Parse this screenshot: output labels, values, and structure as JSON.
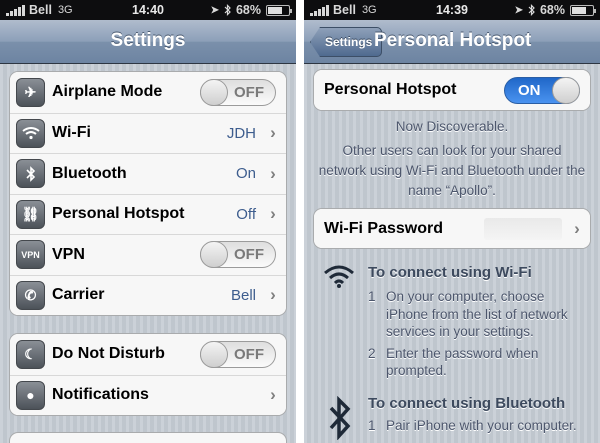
{
  "left": {
    "status": {
      "carrier": "Bell",
      "network": "3G",
      "time": "14:40",
      "battery": "68%"
    },
    "nav_title": "Settings",
    "group1": [
      {
        "label": "Airplane Mode",
        "control": "toggle",
        "toggle_label": "OFF",
        "icon": "airplane-icon",
        "glyph": "✈"
      },
      {
        "label": "Wi-Fi",
        "value": "JDH",
        "icon": "wifi-icon",
        "glyph": ""
      },
      {
        "label": "Bluetooth",
        "value": "On",
        "icon": "bluetooth-icon",
        "glyph": ""
      },
      {
        "label": "Personal Hotspot",
        "value": "Off",
        "icon": "link-icon",
        "glyph": "⛓"
      },
      {
        "label": "VPN",
        "control": "toggle",
        "toggle_label": "OFF",
        "icon": "vpn-icon",
        "glyph": "VPN"
      },
      {
        "label": "Carrier",
        "value": "Bell",
        "icon": "phone-icon",
        "glyph": "✆"
      }
    ],
    "group2": [
      {
        "label": "Do Not Disturb",
        "control": "toggle",
        "toggle_label": "OFF",
        "icon": "moon-icon",
        "glyph": "☾"
      },
      {
        "label": "Notifications",
        "icon": "notifications-icon",
        "glyph": "●"
      }
    ]
  },
  "right": {
    "status": {
      "carrier": "Bell",
      "network": "3G",
      "time": "14:39",
      "battery": "68%"
    },
    "back_label": "Settings",
    "nav_title": "Personal Hotspot",
    "hotspot": {
      "label": "Personal Hotspot",
      "toggle_label": "ON"
    },
    "discover_lines": [
      "Now Discoverable.",
      "Other users can look for your shared",
      "network using Wi-Fi and Bluetooth under the",
      "name “Apollo”."
    ],
    "password_label": "Wi-Fi Password",
    "wifi_section": {
      "title": "To connect using Wi-Fi",
      "steps": [
        {
          "n": "1",
          "lines": [
            "On your computer, choose",
            "iPhone from the list of network",
            "services in your settings."
          ]
        },
        {
          "n": "2",
          "lines": [
            "Enter the password when",
            "prompted."
          ]
        }
      ]
    },
    "bt_section": {
      "title": "To connect using Bluetooth",
      "steps": [
        {
          "n": "1",
          "lines": [
            "Pair iPhone with your computer."
          ]
        }
      ]
    }
  },
  "colors": {
    "value_blue": "#3d5d8e",
    "toggle_on": "#2f7be0"
  }
}
